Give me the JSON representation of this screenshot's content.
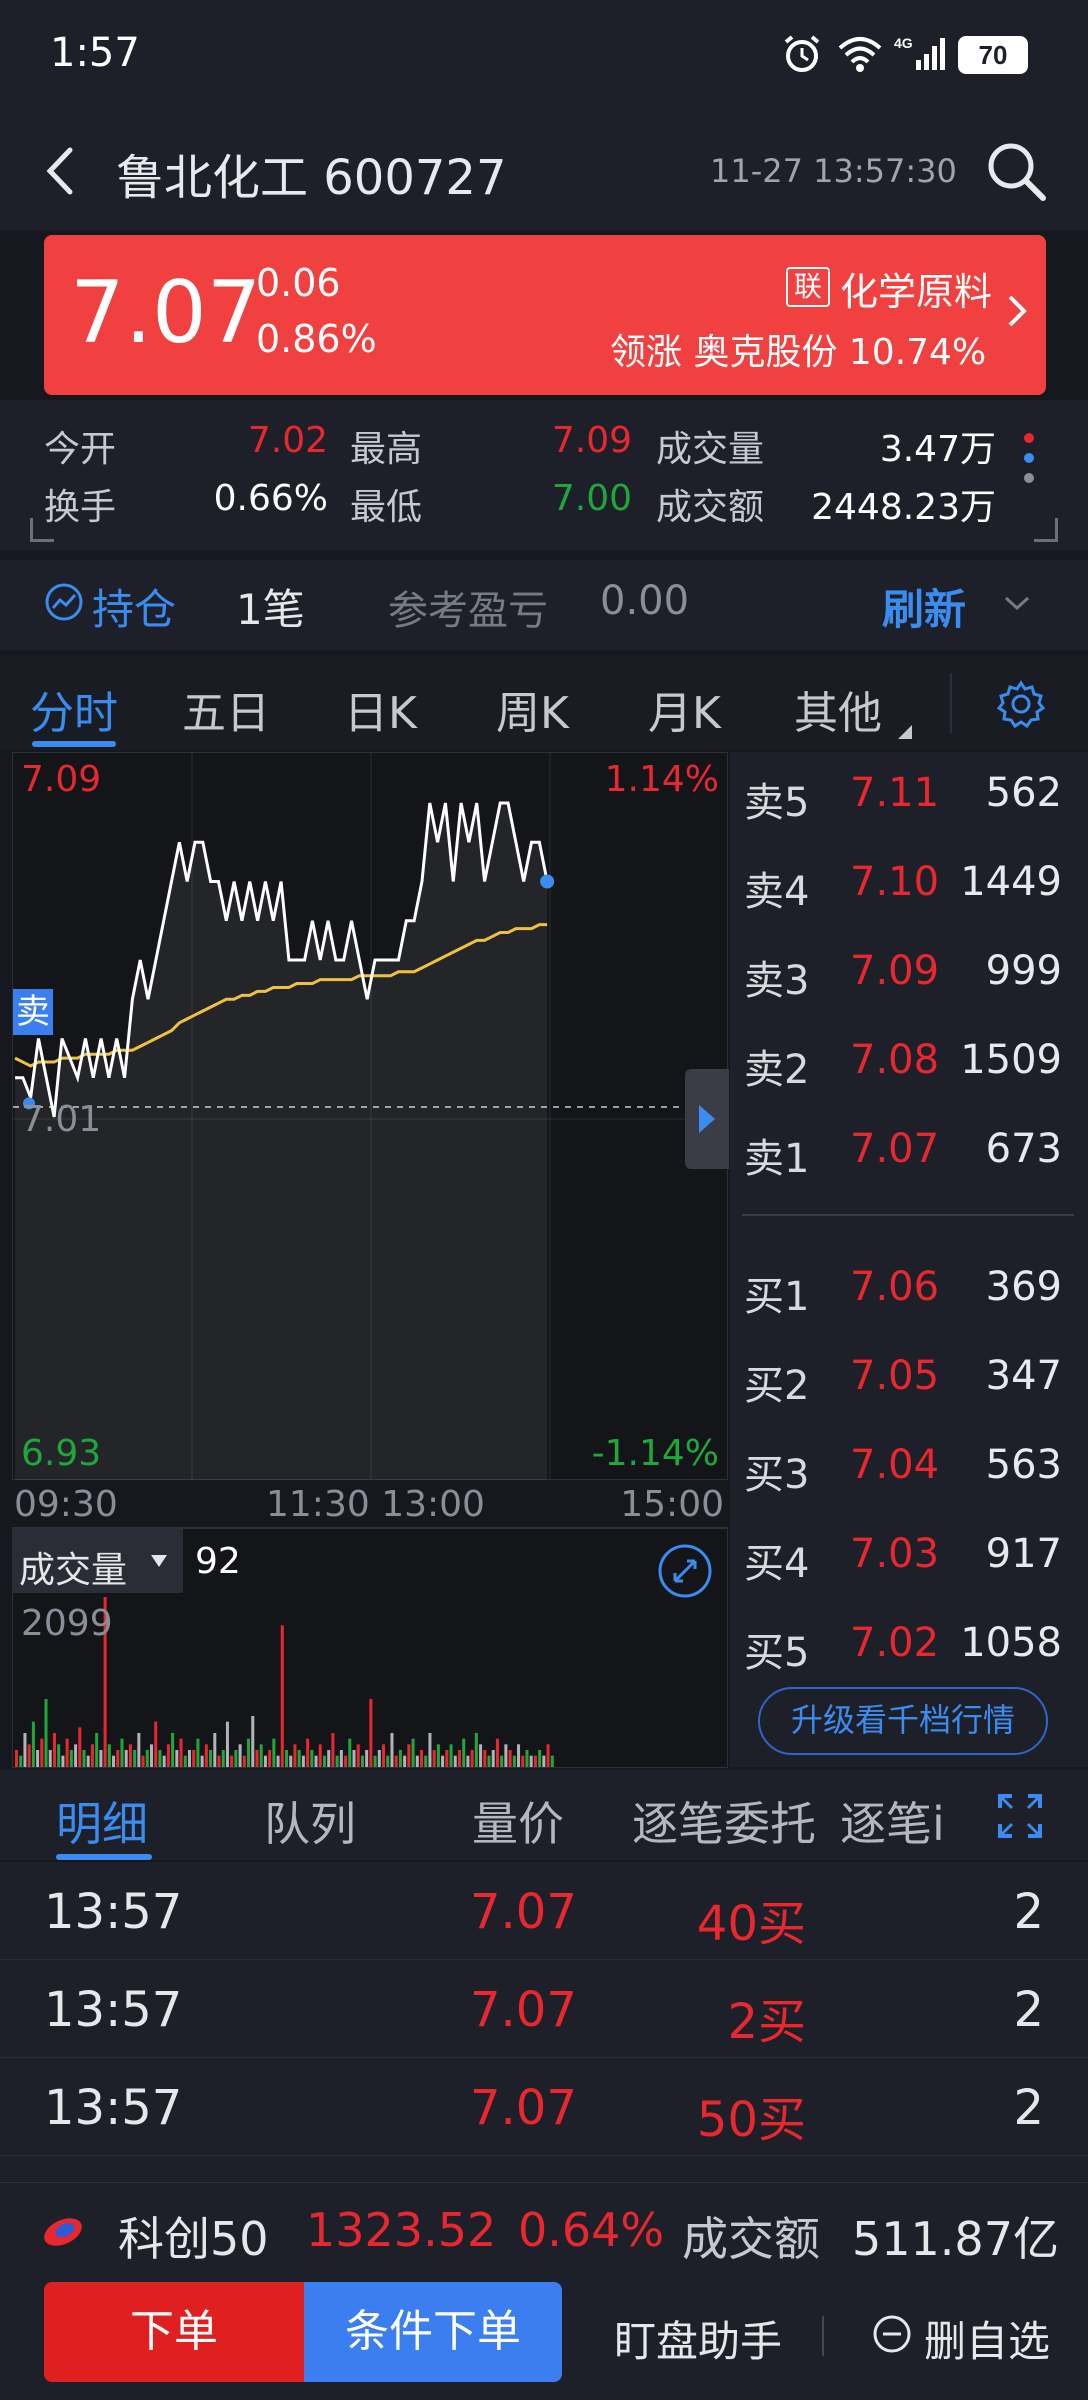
{
  "status_bar": {
    "time": "1:57",
    "battery": "70",
    "network": "4G"
  },
  "header": {
    "title": "鲁北化工 600727",
    "datetime": "11-27 13:57:30"
  },
  "quote": {
    "price": "7.07",
    "change": "0.06",
    "change_pct": "0.86%",
    "sector_badge": "联",
    "sector": "化学原料",
    "leader": "领涨 奥克股份 10.74%",
    "colors": {
      "banner": "#f04040",
      "up": "#e8272f",
      "down": "#1fa83a",
      "accent": "#3a8cf0"
    }
  },
  "stats": {
    "open_label": "今开",
    "open": "7.02",
    "high_label": "最高",
    "high": "7.09",
    "volume_label": "成交量",
    "volume": "3.47万",
    "turnover_label": "换手",
    "turnover": "0.66%",
    "low_label": "最低",
    "low": "7.00",
    "amount_label": "成交额",
    "amount": "2448.23万"
  },
  "position": {
    "label": "持仓",
    "count": "1笔",
    "pnl_label": "参考盈亏",
    "pnl": "0.00",
    "refresh": "刷新"
  },
  "chart_tabs": [
    "分时",
    "五日",
    "日K",
    "周K",
    "月K",
    "其他"
  ],
  "chart_data": {
    "type": "line",
    "y_top_label": "7.09",
    "y_top_pct": "1.14%",
    "y_bottom_label": "6.93",
    "y_bottom_pct": "-1.14%",
    "prev_close_label": "7.01",
    "sell_marker": "卖",
    "ylim": [
      6.93,
      7.09
    ],
    "x_ticks": [
      "09:30",
      "11:30 13:00",
      "15:00"
    ],
    "series": [
      {
        "values": [
          7.02,
          7.02,
          7.015,
          7.03,
          7.02,
          7.01,
          7.03,
          7.025,
          7.02,
          7.03,
          7.02,
          7.03,
          7.02,
          7.03,
          7.02,
          7.04,
          7.05,
          7.04,
          7.05,
          7.06,
          7.07,
          7.08,
          7.07,
          7.08,
          7.08,
          7.07,
          7.07,
          7.06,
          7.07,
          7.06,
          7.07,
          7.06,
          7.07,
          7.06,
          7.07,
          7.05,
          7.05,
          7.05,
          7.06,
          7.05,
          7.06,
          7.05,
          7.05,
          7.06,
          7.05,
          7.04,
          7.05,
          7.05,
          7.05,
          7.05,
          7.06,
          7.06,
          7.07,
          7.09,
          7.08,
          7.09,
          7.07,
          7.09,
          7.08,
          7.09,
          7.07,
          7.08,
          7.09,
          7.09,
          7.08,
          7.07,
          7.08,
          7.08,
          7.07
        ]
      },
      {
        "values": [
          7.025,
          7.024,
          7.023,
          7.024,
          7.024,
          7.024,
          7.025,
          7.025,
          7.025,
          7.026,
          7.026,
          7.026,
          7.026,
          7.027,
          7.027,
          7.027,
          7.028,
          7.029,
          7.03,
          7.031,
          7.032,
          7.034,
          7.035,
          7.036,
          7.037,
          7.038,
          7.039,
          7.04,
          7.04,
          7.041,
          7.041,
          7.042,
          7.042,
          7.043,
          7.043,
          7.043,
          7.044,
          7.044,
          7.044,
          7.045,
          7.045,
          7.045,
          7.045,
          7.045,
          7.046,
          7.046,
          7.046,
          7.046,
          7.046,
          7.047,
          7.047,
          7.047,
          7.048,
          7.049,
          7.05,
          7.051,
          7.052,
          7.053,
          7.054,
          7.055,
          7.055,
          7.056,
          7.057,
          7.057,
          7.058,
          7.058,
          7.058,
          7.059,
          7.059
        ]
      }
    ],
    "volume": {
      "label": "成交量",
      "current": "92",
      "max_label": "2099",
      "bars": [
        3,
        2,
        6,
        4,
        8,
        3,
        5,
        12,
        3,
        6,
        4,
        2,
        5,
        3,
        4,
        7,
        3,
        2,
        4,
        6,
        3,
        30,
        4,
        2,
        3,
        5,
        3,
        4,
        3,
        6,
        2,
        3,
        4,
        8,
        3,
        2,
        4,
        6,
        3,
        5,
        2,
        3,
        3,
        5,
        2,
        4,
        3,
        6,
        2,
        3,
        8,
        2,
        3,
        4,
        2,
        5,
        9,
        3,
        4,
        2,
        3,
        5,
        2,
        25,
        3,
        2,
        4,
        3,
        2,
        5,
        3,
        2,
        4,
        2,
        3,
        6,
        2,
        3,
        2,
        5,
        3,
        4,
        2,
        3,
        12,
        2,
        3,
        4,
        2,
        6,
        2,
        3,
        2,
        4,
        5,
        2,
        3,
        2,
        6,
        3,
        4,
        2,
        3,
        4,
        2,
        3,
        5,
        2,
        3,
        6,
        4,
        3,
        2,
        3,
        5,
        2,
        4,
        3,
        2,
        4,
        2,
        3,
        2,
        2,
        3,
        2,
        4,
        2
      ]
    }
  },
  "order_book": {
    "asks": [
      {
        "label": "卖5",
        "price": "7.11",
        "qty": "562"
      },
      {
        "label": "卖4",
        "price": "7.10",
        "qty": "1449"
      },
      {
        "label": "卖3",
        "price": "7.09",
        "qty": "999"
      },
      {
        "label": "卖2",
        "price": "7.08",
        "qty": "1509"
      },
      {
        "label": "卖1",
        "price": "7.07",
        "qty": "673"
      }
    ],
    "bids": [
      {
        "label": "买1",
        "price": "7.06",
        "qty": "369"
      },
      {
        "label": "买2",
        "price": "7.05",
        "qty": "347"
      },
      {
        "label": "买3",
        "price": "7.04",
        "qty": "563"
      },
      {
        "label": "买4",
        "price": "7.03",
        "qty": "917"
      },
      {
        "label": "买5",
        "price": "7.02",
        "qty": "1058"
      }
    ],
    "upgrade": "升级看千档行情"
  },
  "detail_tabs": [
    "明细",
    "队列",
    "量价",
    "逐笔委托",
    "逐笔i"
  ],
  "trades": [
    {
      "time": "13:57",
      "price": "7.07",
      "vol": "40买",
      "num": "2"
    },
    {
      "time": "13:57",
      "price": "7.07",
      "vol": "2买",
      "num": "2"
    },
    {
      "time": "13:57",
      "price": "7.07",
      "vol": "50买",
      "num": "2"
    }
  ],
  "index_bar": {
    "name": "科创50",
    "value": "1323.52",
    "pct": "0.64%",
    "vol_label": "成交额",
    "vol": "511.87亿"
  },
  "bottom_bar": {
    "order": "下单",
    "cond_order": "条件下单",
    "assistant": "盯盘助手",
    "remove_fav": "删自选"
  }
}
